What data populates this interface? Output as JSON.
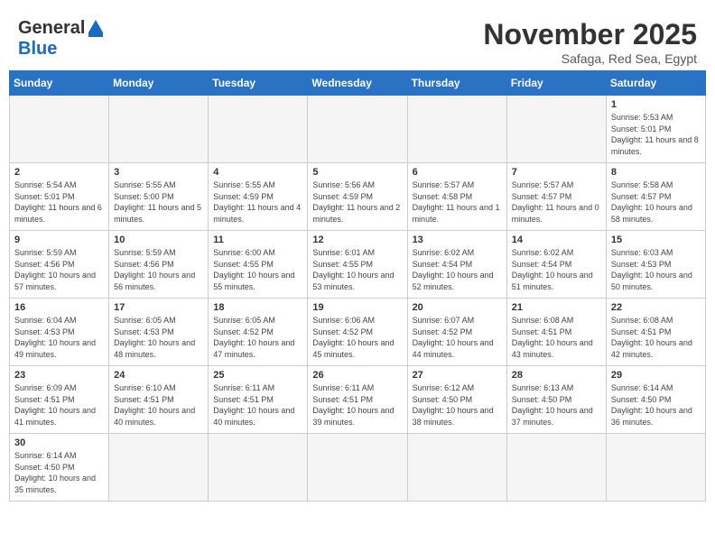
{
  "header": {
    "logo_general": "General",
    "logo_blue": "Blue",
    "month_title": "November 2025",
    "location": "Safaga, Red Sea, Egypt"
  },
  "weekdays": [
    "Sunday",
    "Monday",
    "Tuesday",
    "Wednesday",
    "Thursday",
    "Friday",
    "Saturday"
  ],
  "days": {
    "1": {
      "sunrise": "Sunrise: 5:53 AM",
      "sunset": "Sunset: 5:01 PM",
      "daylight": "Daylight: 11 hours and 8 minutes."
    },
    "2": {
      "sunrise": "Sunrise: 5:54 AM",
      "sunset": "Sunset: 5:01 PM",
      "daylight": "Daylight: 11 hours and 6 minutes."
    },
    "3": {
      "sunrise": "Sunrise: 5:55 AM",
      "sunset": "Sunset: 5:00 PM",
      "daylight": "Daylight: 11 hours and 5 minutes."
    },
    "4": {
      "sunrise": "Sunrise: 5:55 AM",
      "sunset": "Sunset: 4:59 PM",
      "daylight": "Daylight: 11 hours and 4 minutes."
    },
    "5": {
      "sunrise": "Sunrise: 5:56 AM",
      "sunset": "Sunset: 4:59 PM",
      "daylight": "Daylight: 11 hours and 2 minutes."
    },
    "6": {
      "sunrise": "Sunrise: 5:57 AM",
      "sunset": "Sunset: 4:58 PM",
      "daylight": "Daylight: 11 hours and 1 minute."
    },
    "7": {
      "sunrise": "Sunrise: 5:57 AM",
      "sunset": "Sunset: 4:57 PM",
      "daylight": "Daylight: 11 hours and 0 minutes."
    },
    "8": {
      "sunrise": "Sunrise: 5:58 AM",
      "sunset": "Sunset: 4:57 PM",
      "daylight": "Daylight: 10 hours and 58 minutes."
    },
    "9": {
      "sunrise": "Sunrise: 5:59 AM",
      "sunset": "Sunset: 4:56 PM",
      "daylight": "Daylight: 10 hours and 57 minutes."
    },
    "10": {
      "sunrise": "Sunrise: 5:59 AM",
      "sunset": "Sunset: 4:56 PM",
      "daylight": "Daylight: 10 hours and 56 minutes."
    },
    "11": {
      "sunrise": "Sunrise: 6:00 AM",
      "sunset": "Sunset: 4:55 PM",
      "daylight": "Daylight: 10 hours and 55 minutes."
    },
    "12": {
      "sunrise": "Sunrise: 6:01 AM",
      "sunset": "Sunset: 4:55 PM",
      "daylight": "Daylight: 10 hours and 53 minutes."
    },
    "13": {
      "sunrise": "Sunrise: 6:02 AM",
      "sunset": "Sunset: 4:54 PM",
      "daylight": "Daylight: 10 hours and 52 minutes."
    },
    "14": {
      "sunrise": "Sunrise: 6:02 AM",
      "sunset": "Sunset: 4:54 PM",
      "daylight": "Daylight: 10 hours and 51 minutes."
    },
    "15": {
      "sunrise": "Sunrise: 6:03 AM",
      "sunset": "Sunset: 4:53 PM",
      "daylight": "Daylight: 10 hours and 50 minutes."
    },
    "16": {
      "sunrise": "Sunrise: 6:04 AM",
      "sunset": "Sunset: 4:53 PM",
      "daylight": "Daylight: 10 hours and 49 minutes."
    },
    "17": {
      "sunrise": "Sunrise: 6:05 AM",
      "sunset": "Sunset: 4:53 PM",
      "daylight": "Daylight: 10 hours and 48 minutes."
    },
    "18": {
      "sunrise": "Sunrise: 6:05 AM",
      "sunset": "Sunset: 4:52 PM",
      "daylight": "Daylight: 10 hours and 47 minutes."
    },
    "19": {
      "sunrise": "Sunrise: 6:06 AM",
      "sunset": "Sunset: 4:52 PM",
      "daylight": "Daylight: 10 hours and 45 minutes."
    },
    "20": {
      "sunrise": "Sunrise: 6:07 AM",
      "sunset": "Sunset: 4:52 PM",
      "daylight": "Daylight: 10 hours and 44 minutes."
    },
    "21": {
      "sunrise": "Sunrise: 6:08 AM",
      "sunset": "Sunset: 4:51 PM",
      "daylight": "Daylight: 10 hours and 43 minutes."
    },
    "22": {
      "sunrise": "Sunrise: 6:08 AM",
      "sunset": "Sunset: 4:51 PM",
      "daylight": "Daylight: 10 hours and 42 minutes."
    },
    "23": {
      "sunrise": "Sunrise: 6:09 AM",
      "sunset": "Sunset: 4:51 PM",
      "daylight": "Daylight: 10 hours and 41 minutes."
    },
    "24": {
      "sunrise": "Sunrise: 6:10 AM",
      "sunset": "Sunset: 4:51 PM",
      "daylight": "Daylight: 10 hours and 40 minutes."
    },
    "25": {
      "sunrise": "Sunrise: 6:11 AM",
      "sunset": "Sunset: 4:51 PM",
      "daylight": "Daylight: 10 hours and 40 minutes."
    },
    "26": {
      "sunrise": "Sunrise: 6:11 AM",
      "sunset": "Sunset: 4:51 PM",
      "daylight": "Daylight: 10 hours and 39 minutes."
    },
    "27": {
      "sunrise": "Sunrise: 6:12 AM",
      "sunset": "Sunset: 4:50 PM",
      "daylight": "Daylight: 10 hours and 38 minutes."
    },
    "28": {
      "sunrise": "Sunrise: 6:13 AM",
      "sunset": "Sunset: 4:50 PM",
      "daylight": "Daylight: 10 hours and 37 minutes."
    },
    "29": {
      "sunrise": "Sunrise: 6:14 AM",
      "sunset": "Sunset: 4:50 PM",
      "daylight": "Daylight: 10 hours and 36 minutes."
    },
    "30": {
      "sunrise": "Sunrise: 6:14 AM",
      "sunset": "Sunset: 4:50 PM",
      "daylight": "Daylight: 10 hours and 35 minutes."
    }
  }
}
